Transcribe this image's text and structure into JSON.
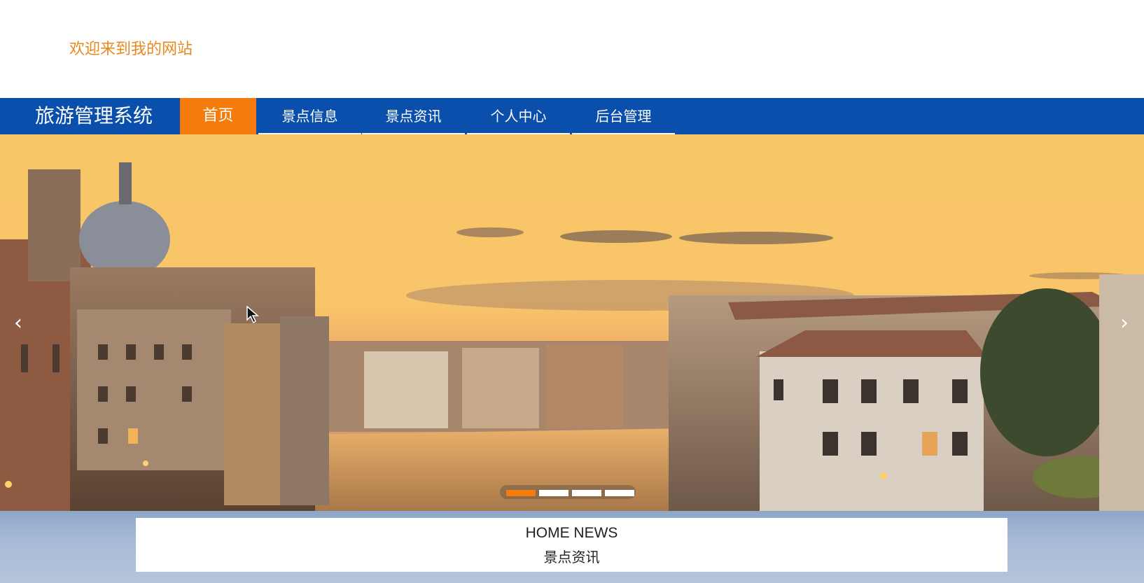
{
  "header": {
    "welcome_text": "欢迎来到我的网站"
  },
  "nav": {
    "brand": "旅游管理系统",
    "items": [
      {
        "label": "首页",
        "active": true
      },
      {
        "label": "景点信息",
        "active": false
      },
      {
        "label": "景点资讯",
        "active": false
      },
      {
        "label": "个人中心",
        "active": false
      },
      {
        "label": "后台管理",
        "active": false
      }
    ]
  },
  "banner": {
    "prev_glyph": "‹",
    "next_glyph": "›",
    "slide_count": 4,
    "active_slide": 1
  },
  "news": {
    "title": "HOME NEWS",
    "subtitle": "景点资讯"
  },
  "colors": {
    "nav_bg": "#0a4fab",
    "accent": "#f47b0c",
    "welcome": "#e8891c"
  }
}
